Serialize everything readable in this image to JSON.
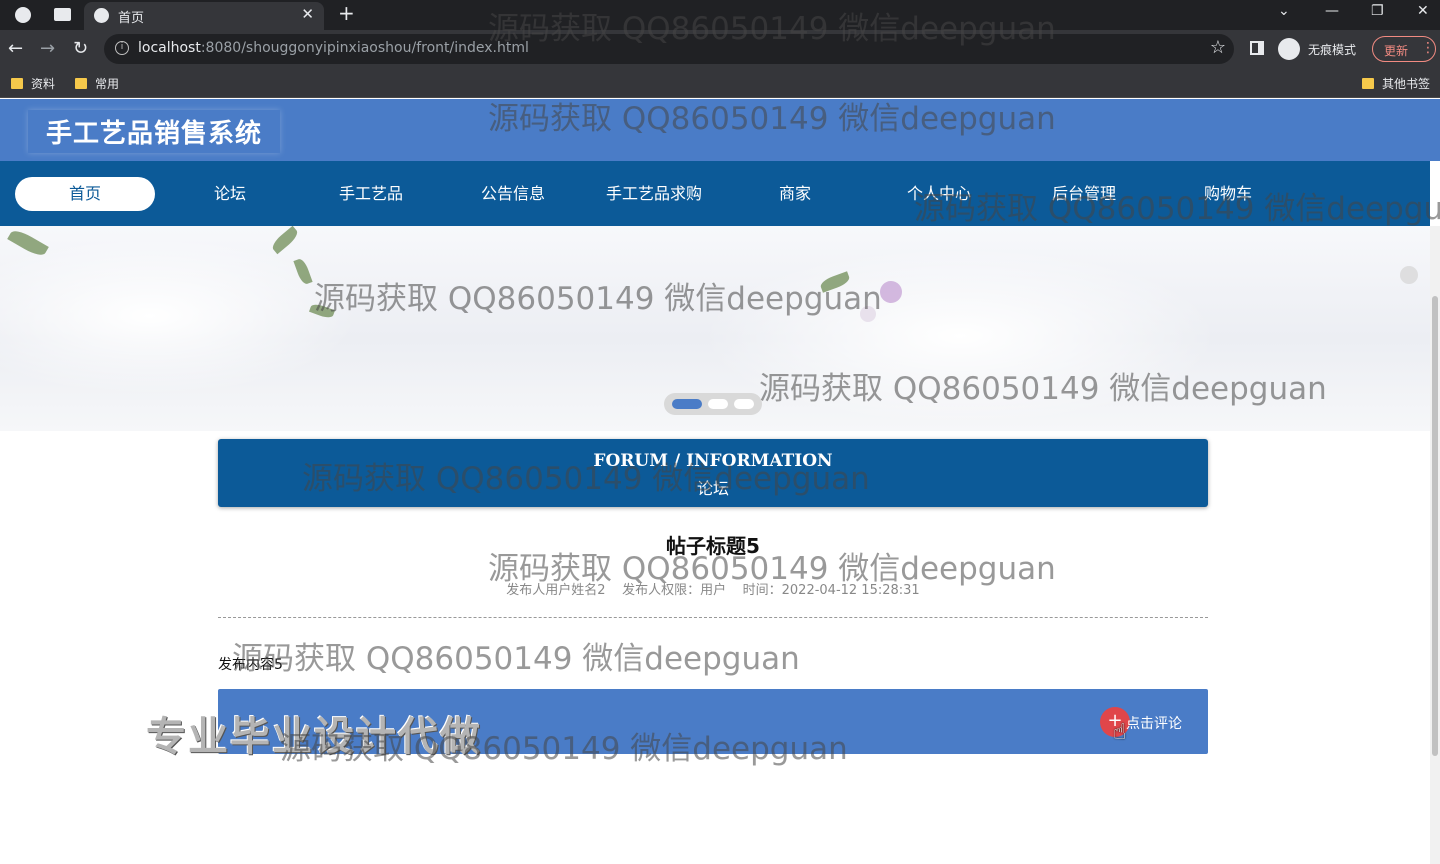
{
  "browser": {
    "tab_title": "首页",
    "url_host": "localhost",
    "url_rest": ":8080/shouggonyipinxiaoshou/front/index.html",
    "incognito_label": "无痕模式",
    "update_label": "更新",
    "bookmarks": [
      "资料",
      "常用"
    ],
    "other_bookmarks": "其他书签"
  },
  "site": {
    "title": "手工艺品销售系统",
    "nav": [
      "首页",
      "论坛",
      "手工艺品",
      "公告信息",
      "手工艺品求购",
      "商家",
      "个人中心",
      "后台管理",
      "购物车"
    ],
    "active_nav": "首页",
    "colors": {
      "header": "#4a7cc7",
      "nav": "#0c5a98",
      "comment_button": "#e0464a"
    }
  },
  "forum": {
    "heading_en": "FORUM / INFORMATION",
    "heading_cn": "论坛"
  },
  "post": {
    "title": "帖子标题5",
    "meta": "发布人用户姓名2    发布人权限：用户    时间：2022-04-12 15:28:31",
    "content": "发布内容5",
    "comment_label": "点击评论"
  },
  "overlay": {
    "watermark": "源码获取 QQ86050149 微信deepguan",
    "ad": "专业毕业设计代做"
  }
}
